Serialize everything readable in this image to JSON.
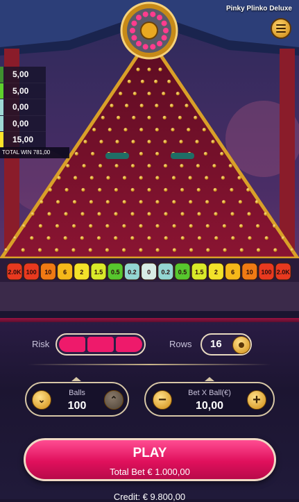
{
  "game": {
    "title": "Pinky Plinko Deluxe"
  },
  "history": [
    {
      "value": "5,00",
      "color": "#3f8f2f"
    },
    {
      "value": "5,00",
      "color": "#5fd12c"
    },
    {
      "value": "0,00",
      "color": "#9fd8d4"
    },
    {
      "value": "0,00",
      "color": "#9fd8d4"
    },
    {
      "value": "15,00",
      "color": "#ffe22a"
    }
  ],
  "total_win": {
    "label": "TOTAL WIN",
    "value": "781,00"
  },
  "multipliers": [
    {
      "label": "2.0K",
      "color": "#e8391f"
    },
    {
      "label": "100",
      "color": "#e8391f"
    },
    {
      "label": "10",
      "color": "#f07a14"
    },
    {
      "label": "6",
      "color": "#f5b81a"
    },
    {
      "label": "2",
      "color": "#f3e22a"
    },
    {
      "label": "1.5",
      "color": "#d9ea2a"
    },
    {
      "label": "0.5",
      "color": "#57c72e"
    },
    {
      "label": "0.2",
      "color": "#93d6d2"
    },
    {
      "label": "0",
      "color": "#d8ece6"
    },
    {
      "label": "0.2",
      "color": "#93d6d2"
    },
    {
      "label": "0.5",
      "color": "#57c72e"
    },
    {
      "label": "1.5",
      "color": "#d9ea2a"
    },
    {
      "label": "2",
      "color": "#f3e22a"
    },
    {
      "label": "6",
      "color": "#f5b81a"
    },
    {
      "label": "10",
      "color": "#f07a14"
    },
    {
      "label": "100",
      "color": "#e8391f"
    },
    {
      "label": "2.0K",
      "color": "#e8391f"
    }
  ],
  "controls": {
    "risk_label": "Risk",
    "rows_label": "Rows",
    "rows_value": "16",
    "balls_label": "Balls",
    "balls_value": "100",
    "bet_label": "Bet X Ball(€)",
    "bet_value": "10,00",
    "play_label": "PLAY",
    "total_bet": "Total Bet € 1.000,00",
    "credit": "Credit: € 9.800,00"
  },
  "colors": {
    "accent": "#ee1a6b",
    "gold": "#d89a1c",
    "board": "#7a0f2c"
  }
}
